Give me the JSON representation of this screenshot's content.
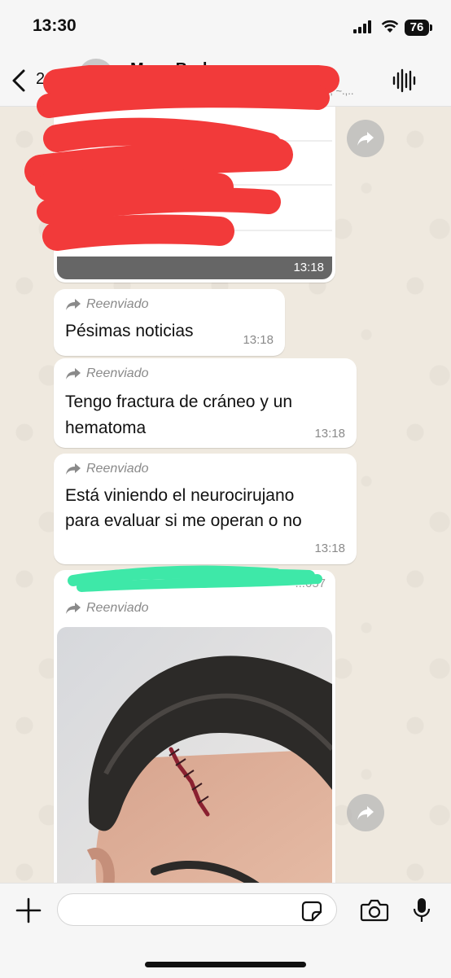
{
  "status_bar": {
    "time": "13:30",
    "battery": "76",
    "icons": [
      "cellular-signal-icon",
      "wifi-icon",
      "battery-icon"
    ]
  },
  "header": {
    "back_count": "2",
    "title": "Mesa Bodeguera",
    "subtitle": "o, ~.,..",
    "icons": [
      "chevron-left-icon",
      "avatar",
      "audio-waveform-icon"
    ]
  },
  "messages": [
    {
      "type": "image",
      "time": "13:18"
    },
    {
      "forwarded_label": "Reenviado",
      "text": "Pésimas noticias",
      "time": "13:18"
    },
    {
      "forwarded_label": "Reenviado",
      "text_lines": [
        "Tengo fractura de cráneo y un",
        "hematoma"
      ],
      "time": "13:18"
    },
    {
      "forwarded_label": "Reenviado",
      "text_lines": [
        "Está viniendo el neurocirujano",
        "para evaluar si me operan o no"
      ],
      "time": "13:18"
    },
    {
      "type": "image",
      "sender_partial": "...057",
      "forwarded_label": "Reenviado"
    }
  ],
  "composer": {
    "placeholder": "",
    "icons": [
      "plus-icon",
      "sticker-icon",
      "camera-icon",
      "microphone-icon"
    ]
  },
  "colors": {
    "wallpaper": "#efe9df",
    "bubble": "#ffffff",
    "redaction_red": "#f23a3a",
    "redaction_green": "#3ee8a8",
    "meta_text": "#8a8a8a"
  }
}
